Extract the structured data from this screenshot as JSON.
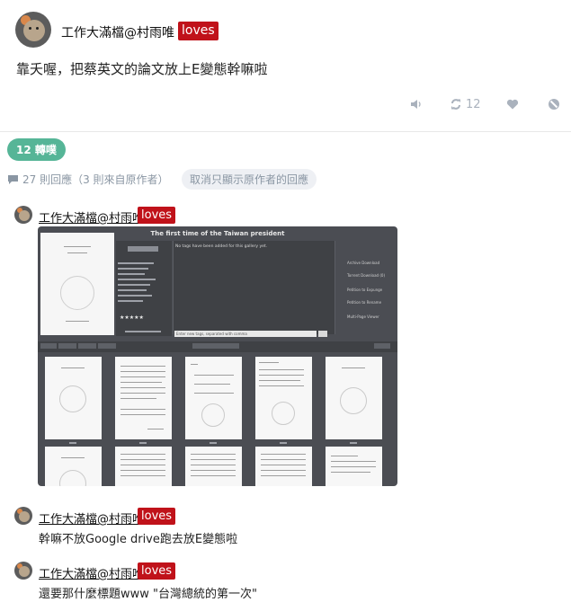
{
  "post": {
    "author": "工作大滿檔@村雨唯",
    "tag": "loves",
    "text": "靠夭喔，把蔡英文的論文放上E變態幹嘛啦",
    "actions": {
      "share_icon": "retweet-icon",
      "share_count": "12",
      "like_icon": "heart-icon",
      "mute_icon": "speaker-icon",
      "block_icon": "block-icon"
    }
  },
  "shares": {
    "label": "12 轉噗"
  },
  "comments_meta": {
    "count_label": "27 則回應（3 則來自原作者）",
    "filter_label": "取消只顯示原作者的回應"
  },
  "replies": [
    {
      "author": "工作大滿檔@村雨唯",
      "tag": "loves",
      "screenshot": {
        "title": "The first time of the Taiwan president",
        "tags_message": "No tags have been added for this gallery yet.",
        "tag_placeholder": "Enter new tags, separated with comma",
        "side_links": [
          "Archive Download",
          "Torrent Download (0)",
          "Petition to Expunge",
          "Petition to Rename",
          "Multi-Page Viewer"
        ]
      }
    },
    {
      "author": "工作大滿檔@村雨唯",
      "tag": "loves",
      "text": "幹嘛不放Google drive跑去放E變態啦"
    },
    {
      "author": "工作大滿檔@村雨唯",
      "tag": "loves",
      "text": "還要那什麼標題www \"台灣總統的第一次\""
    }
  ],
  "colors": {
    "tag_bg": "#c0121a",
    "share_pill_bg": "#56b597",
    "icon_gray": "#aab2bd"
  }
}
